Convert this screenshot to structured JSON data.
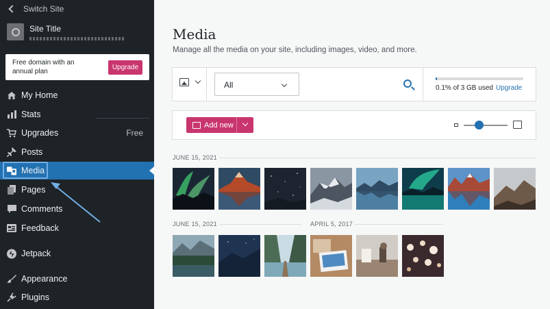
{
  "sidebar": {
    "switch_site": "Switch Site",
    "site_title": "Site Title",
    "promo_text": "Free domain with an annual plan",
    "promo_button": "Upgrade",
    "items": [
      {
        "label": "My Home",
        "icon": "home-icon",
        "badge": ""
      },
      {
        "label": "Stats",
        "icon": "stats-icon",
        "badge": ""
      },
      {
        "label": "Upgrades",
        "icon": "cart-icon",
        "badge": "Free"
      },
      {
        "label": "Posts",
        "icon": "pin-icon",
        "badge": ""
      },
      {
        "label": "Media",
        "icon": "media-icon",
        "badge": ""
      },
      {
        "label": "Pages",
        "icon": "pages-icon",
        "badge": ""
      },
      {
        "label": "Comments",
        "icon": "comment-icon",
        "badge": ""
      },
      {
        "label": "Feedback",
        "icon": "feedback-icon",
        "badge": ""
      },
      {
        "label": "Jetpack",
        "icon": "jetpack-icon",
        "badge": ""
      },
      {
        "label": "Appearance",
        "icon": "brush-icon",
        "badge": ""
      },
      {
        "label": "Plugins",
        "icon": "plugin-icon",
        "badge": ""
      }
    ]
  },
  "main": {
    "title": "Media",
    "subtitle": "Manage all the media on your site, including images, video, and more.",
    "filter_value": "All",
    "storage_text": "0.1% of 3 GB used",
    "storage_fraction": 0.01,
    "storage_upgrade": "Upgrade",
    "add_new": "Add new",
    "zoom_level": 0.35,
    "date1": "JUNE 15, 2021",
    "date2": "JUNE 15, 2021",
    "date3": "APRIL 5, 2017"
  },
  "colors": {
    "accent": "#2271b1",
    "brand_pink": "#c9356e",
    "sidebar_bg": "#1e2327"
  }
}
